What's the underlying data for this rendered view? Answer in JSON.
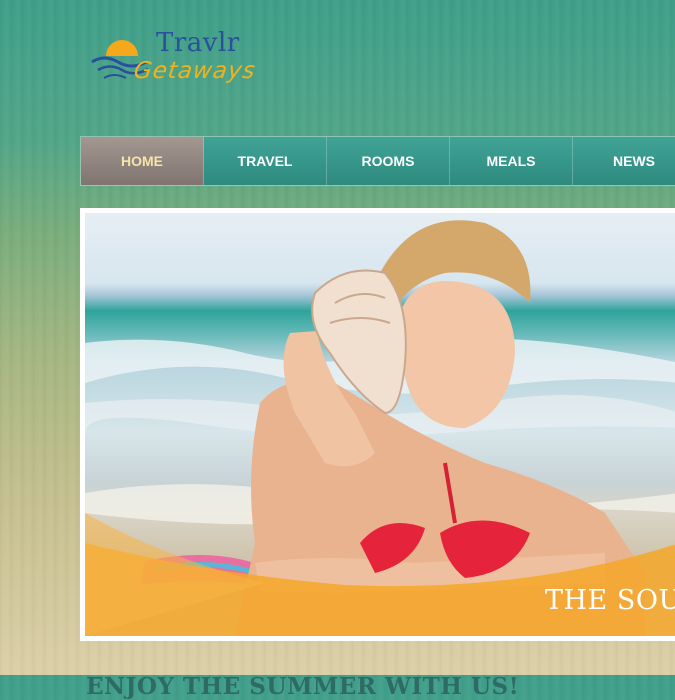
{
  "logo": {
    "brand_line1": "Travlr",
    "brand_line2": "Getaways",
    "sun_icon": "sun-over-sea-icon",
    "colors": {
      "travlr": "#2a4f9c",
      "getaways": "#f2b21c"
    }
  },
  "nav": {
    "items": [
      {
        "label": "HOME",
        "active": true
      },
      {
        "label": "TRAVEL",
        "active": false
      },
      {
        "label": "ROOMS",
        "active": false
      },
      {
        "label": "MEALS",
        "active": false
      },
      {
        "label": "NEWS",
        "active": false
      }
    ],
    "colors": {
      "bar": "#2e8a7f",
      "active": "#8c817b",
      "active_text": "#f6e4a8"
    }
  },
  "hero": {
    "caption": "THE SOU",
    "image": "beach-woman-with-seashell",
    "band_color": "#f5a623"
  },
  "headline": "ENJOY THE SUMMER WITH US!"
}
